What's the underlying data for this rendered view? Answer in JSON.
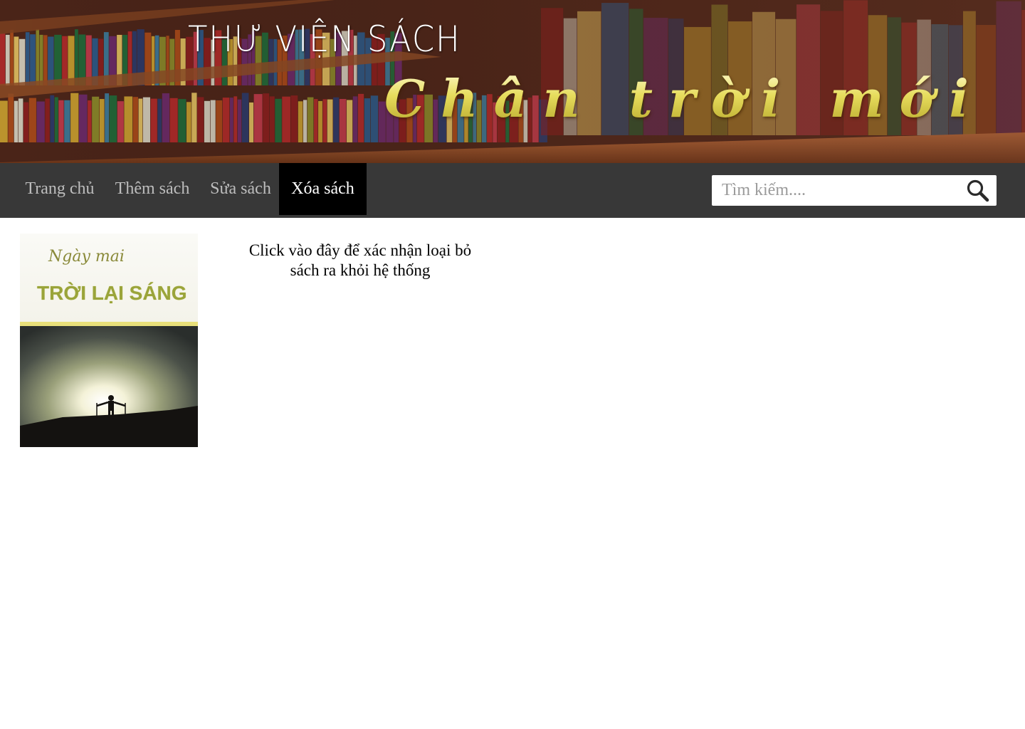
{
  "header": {
    "site_title": "THƯ VIỆN SÁCH",
    "slogan": "Chân trời mới"
  },
  "nav": {
    "items": [
      {
        "label": "Trang chủ",
        "active": false
      },
      {
        "label": "Thêm sách",
        "active": false
      },
      {
        "label": "Sửa sách",
        "active": false
      },
      {
        "label": "Xóa sách",
        "active": true
      }
    ],
    "search": {
      "placeholder": "Tìm kiếm....",
      "value": "",
      "icon": "search-icon"
    }
  },
  "main": {
    "book": {
      "cover_subtitle": "Ngày mai",
      "cover_title": "TRỜI LẠI SÁNG"
    },
    "delete_prompt": "Click vào đây để xác nhận loại bỏ sách ra khỏi hệ thống"
  },
  "colors": {
    "nav_background": "#383838",
    "nav_active_background": "#000000",
    "nav_text": "#bdbdbd",
    "slogan_gold": "#e6dc5c"
  }
}
